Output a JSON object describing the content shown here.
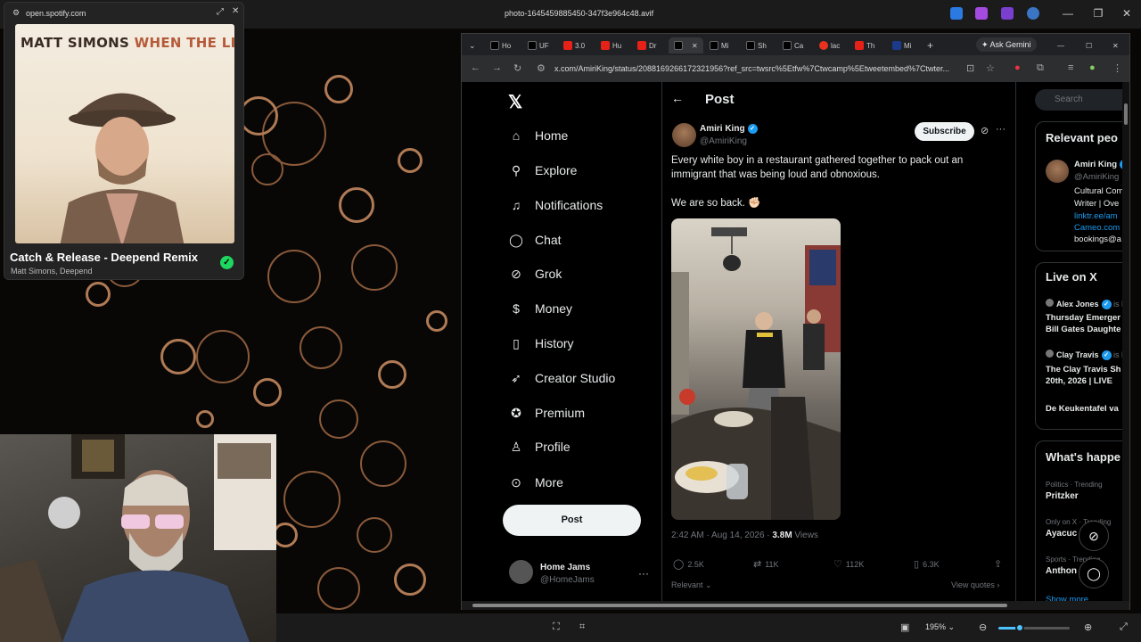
{
  "viewer": {
    "title": "photo-1645459885450-347f3e964c48.avif",
    "zoom": "195%",
    "zoom_slider_level": 0.3
  },
  "spotify": {
    "url": "open.spotify.com",
    "album_artist_text": "MATT SIMONS",
    "album_title_text": "WHEN THE LIGHTS GO DOWN",
    "track": "Catch & Release - Deepend Remix",
    "artists": "Matt Simons, Deepend"
  },
  "browser": {
    "tabs": [
      "Ho",
      "UF",
      "3.0",
      "Hu",
      "Dr",
      "",
      "Mi",
      "Sh",
      "Ca",
      "lac",
      "Th",
      "Mi"
    ],
    "gemini": "Ask Gemini",
    "url": "x.com/AmiriKing/status/2088169266172321956?ref_src=twsrc%5Etfw%7Ctwcamp%5Etweetembed%7Ctwter..."
  },
  "xnav": {
    "home": "Home",
    "explore": "Explore",
    "notifications": "Notifications",
    "chat": "Chat",
    "grok": "Grok",
    "money": "Money",
    "history": "History",
    "creator_studio": "Creator Studio",
    "premium": "Premium",
    "profile": "Profile",
    "more": "More",
    "post_button": "Post",
    "account_name": "Home Jams",
    "account_handle": "@HomeJams"
  },
  "post": {
    "header": "Post",
    "author": "Amiri King",
    "handle": "@AmiriKing",
    "subscribe": "Subscribe",
    "text": "Every white boy in a restaurant gathered together to pack out an immigrant that was being loud and obnoxious.",
    "text2": "We are so back. ✊🏻",
    "time": "2:42 AM · Aug 14, 2026 · ",
    "views_count": "3.8M",
    "views_label": " Views",
    "replies": "2.5K",
    "reposts": "11K",
    "likes": "112K",
    "bookmarks": "6.3K",
    "relevant": "Relevant",
    "view_quotes": "View quotes"
  },
  "right": {
    "search_placeholder": "Search",
    "relevant_heading": "Relevant peo",
    "rel_name": "Amiri King",
    "rel_handle": "@AmiriKing",
    "rel_bio1": "Cultural Com",
    "rel_bio2": "Writer | Ove",
    "rel_link1": "linktr.ee/am",
    "rel_link2": "Cameo.com",
    "rel_email": "bookings@a",
    "live_heading": "Live on X",
    "live1_host": "Alex Jones",
    "live1_suffix": "is h",
    "live1_title1": "Thursday Emerger",
    "live1_title2": "Bill Gates Daughte",
    "live2_host": "Clay Travis",
    "live2_suffix": "is h",
    "live2_title1": "The Clay Travis Sh",
    "live2_title2": "20th, 2026 | LIVE",
    "live3_title": "De Keukentafel va",
    "happening_heading": "What's happe",
    "trend1_meta": "Politics · Trending",
    "trend1": "Pritzker",
    "trend2_meta": "Only on X · Trending",
    "trend2": "Ayacuc",
    "trend3_meta": "Sports · Trending",
    "trend3": "Anthon",
    "show_more": "Show more"
  }
}
